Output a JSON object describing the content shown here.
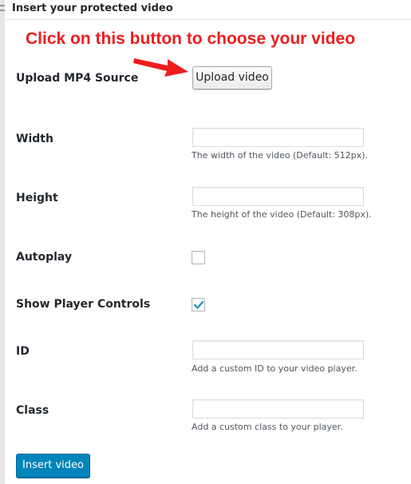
{
  "window": {
    "title": "Insert your protected video"
  },
  "annotation": {
    "text": "Click on this button to choose your video",
    "color": "#ee1d1d"
  },
  "form": {
    "upload": {
      "label": "Upload MP4 Source",
      "button_label": "Upload video"
    },
    "width": {
      "label": "Width",
      "value": "",
      "hint": "The width of the video (Default: 512px)."
    },
    "height": {
      "label": "Height",
      "value": "",
      "hint": "The height of the video (Default: 308px)."
    },
    "autoplay": {
      "label": "Autoplay",
      "checked": false
    },
    "show_controls": {
      "label": "Show Player Controls",
      "checked": true
    },
    "id": {
      "label": "ID",
      "value": "",
      "hint": "Add a custom ID to your video player."
    },
    "class": {
      "label": "Class",
      "value": "",
      "hint": "Add a custom class to your player."
    },
    "submit_label": "Insert video"
  },
  "colors": {
    "primary_button": "#0085ba",
    "checkmark": "#1e8cbe"
  },
  "icons": [
    "arrow-pointer-icon",
    "checkmark-icon"
  ]
}
